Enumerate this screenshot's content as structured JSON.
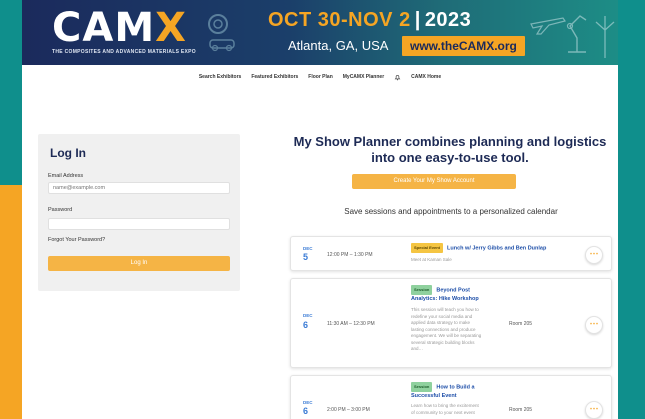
{
  "banner": {
    "logo_main": "CAM",
    "logo_x": "X",
    "logo_tagline": "THE COMPOSITES AND ADVANCED MATERIALS EXPO",
    "dates": "OCT 30-NOV 2",
    "separator": "|",
    "year": "2023",
    "location": "Atlanta, GA, USA",
    "url": "www.theCAMX.org"
  },
  "nav": {
    "items": [
      "Search Exhibitors",
      "Featured Exhibitors",
      "Floor Plan",
      "MyCAMX Planner",
      "CAMX Home"
    ]
  },
  "login": {
    "title": "Log In",
    "email_label": "Email Address",
    "email_placeholder": "name@example.com",
    "password_label": "Password",
    "forgot_link": "Forgot Your Password?",
    "login_button": "Log In"
  },
  "promo": {
    "headline_line1": "My Show Planner combines planning and logistics",
    "headline_line2": "into one easy-to-use tool.",
    "create_button": "Create Your My Show Account",
    "subtitle": "Save sessions and appointments to a personalized calendar"
  },
  "schedule": [
    {
      "month": "DEC",
      "day": "5",
      "time": "12:00 PM – 1:30 PM",
      "tag": "Special Event",
      "title": "Lunch w/ Jerry Gibbs and Ben Dunlap",
      "desc": "Meet at Kaman Sale",
      "room": ""
    },
    {
      "month": "DEC",
      "day": "6",
      "time": "11:30 AM – 12:30 PM",
      "tag": "Session",
      "title": "Beyond Post Analytics: Hike Workshop",
      "desc": "This session will teach you how to redefine your social media and applied data strategy to make lasting connections and produce engagement. We will be separating several strategic building blocks and…",
      "room": "Room 205"
    },
    {
      "month": "DEC",
      "day": "6",
      "time": "2:00 PM – 3:00 PM",
      "tag": "Session",
      "title": "How to Build a Successful Event",
      "desc": "Learn how to bring the excitement of community to your next event",
      "room": "Room 205"
    }
  ],
  "colors": {
    "brand_navy": "#1b2a5c",
    "brand_orange": "#f5a524",
    "brand_teal": "#0f8f8c",
    "date_blue": "#3a7bd5"
  },
  "icons": {
    "more": "more-dots-icon",
    "bell": "bell-icon"
  }
}
